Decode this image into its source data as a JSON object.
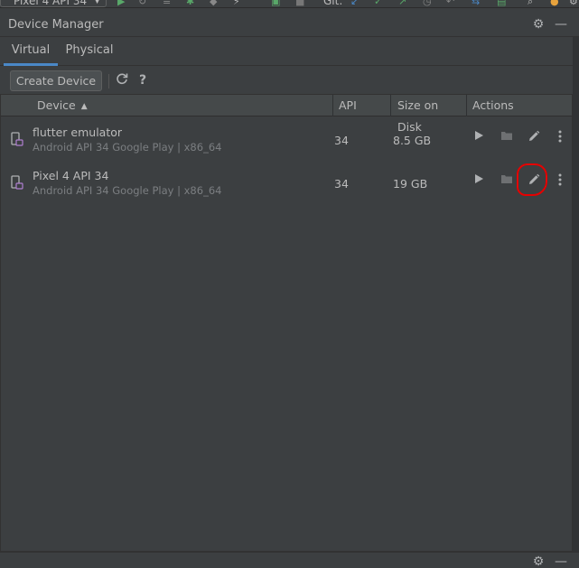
{
  "toolbar": {
    "device_selector": "Pixel 4 API 34",
    "git_label": "Git:"
  },
  "panel": {
    "title": "Device Manager"
  },
  "tabs": [
    {
      "label": "Virtual",
      "active": true
    },
    {
      "label": "Physical",
      "active": false
    }
  ],
  "actions": {
    "create_device": "Create Device",
    "refresh_icon": "refresh-icon",
    "help_icon": "help-icon",
    "help_glyph": "?"
  },
  "table": {
    "columns": [
      "Device",
      "API",
      "Size on Disk",
      "Actions"
    ],
    "sort_column": "Device",
    "rows": [
      {
        "name": "flutter emulator",
        "detail": "Android API 34 Google Play | x86_64",
        "api": "34",
        "size": "8.5 GB"
      },
      {
        "name": "Pixel 4 API 34",
        "detail": "Android API 34 Google Play | x86_64",
        "api": "34",
        "size": "19 GB"
      }
    ]
  },
  "colors": {
    "accent": "#4a88c7",
    "highlight": "#e60000",
    "background": "#3c3f41"
  }
}
